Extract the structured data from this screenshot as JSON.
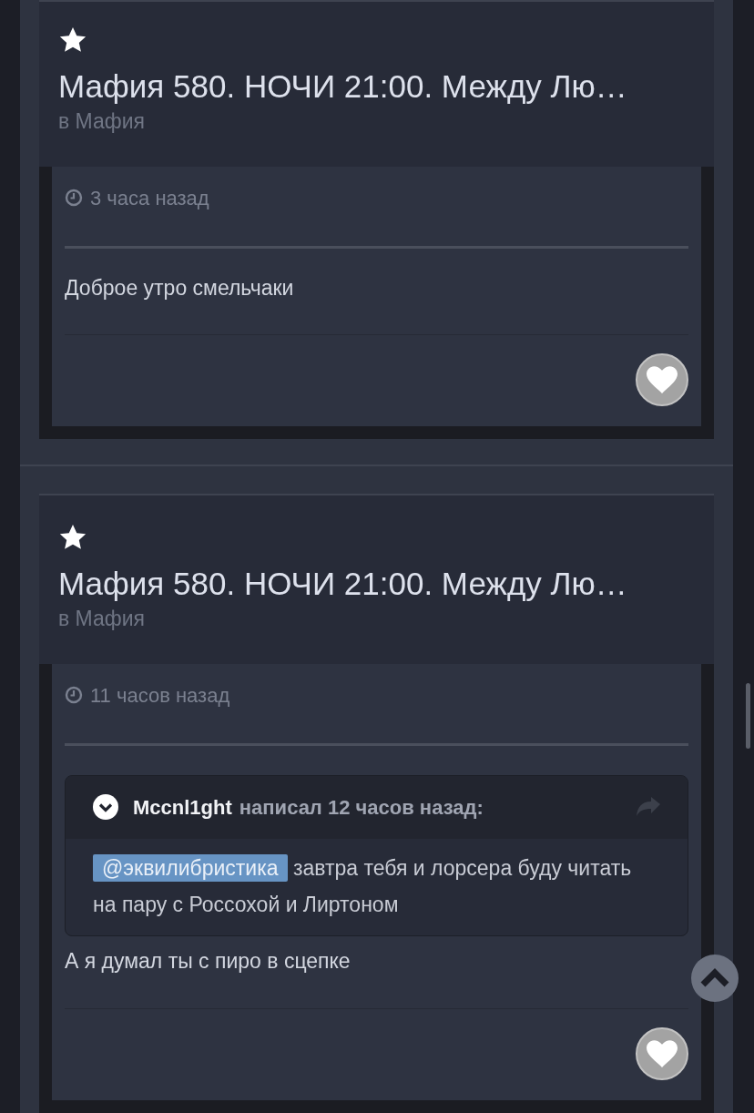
{
  "posts": [
    {
      "title": "Мафия 580. НОЧИ 21:00. Между Лю…",
      "forum": "в Мафия",
      "time": "3 часа назад",
      "text": "Доброе утро смельчаки"
    },
    {
      "title": "Мафия 580. НОЧИ 21:00. Между Лю…",
      "forum": "в Мафия",
      "time": "11 часов назад",
      "quote": {
        "author": "Mccnl1ght",
        "meta": "написал 12 часов назад:",
        "mention": "@эквилибристика",
        "text": "завтра тебя и лорсера буду читать на пару с Россохой и Лиртоном"
      },
      "text": "А я думал ты с пиро в сцепке"
    }
  ]
}
